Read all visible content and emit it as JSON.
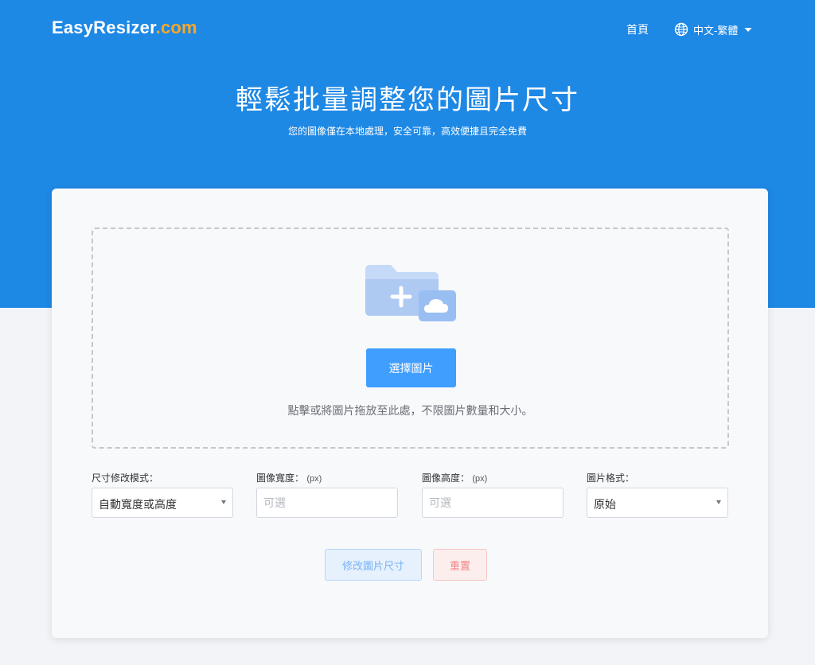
{
  "header": {
    "brand_name": "EasyResizer",
    "brand_tld": ".com",
    "nav_home": "首頁",
    "language": "中文-繁體"
  },
  "hero": {
    "title": "輕鬆批量調整您的圖片尺寸",
    "subtitle": "您的圖像僅在本地處理，安全可靠，高效便捷且完全免費"
  },
  "upload": {
    "choose_button": "選擇圖片",
    "hint": "點擊或將圖片拖放至此處，不限圖片數量和大小。"
  },
  "form": {
    "mode_label": "尺寸修改模式：",
    "mode_value": "自動寬度或高度",
    "width_label": "圖像寬度：",
    "width_unit": "(px)",
    "width_placeholder": "可選",
    "height_label": "圖像高度：",
    "height_unit": "(px)",
    "height_placeholder": "可選",
    "format_label": "圖片格式：",
    "format_value": "原始"
  },
  "actions": {
    "resize_button": "修改圖片尺寸",
    "reset_button": "重置"
  },
  "colors": {
    "primary": "#1e88e5",
    "button_blue": "#409eff",
    "brand_accent": "#f9a825",
    "reset_red": "#f08585"
  },
  "icons": {
    "language": "globe-icon",
    "dropdown": "caret-down-icon",
    "upload": "folder-add-cloud-icon"
  }
}
